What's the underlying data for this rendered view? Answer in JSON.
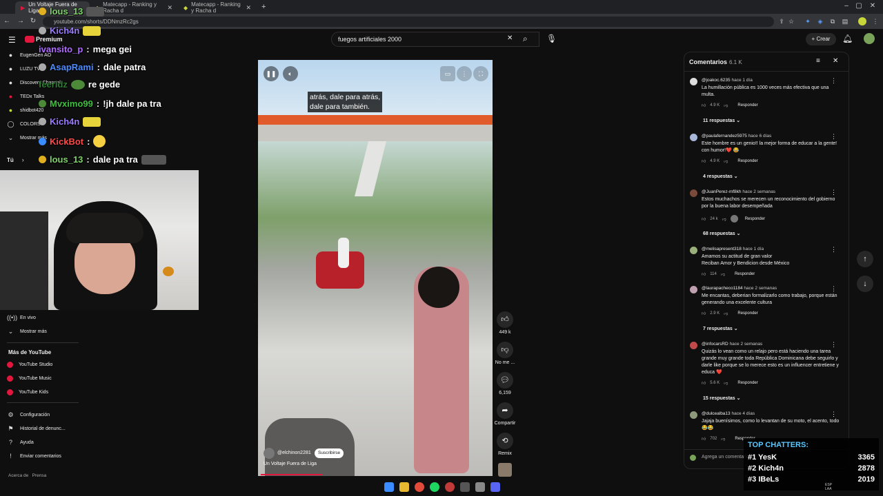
{
  "browser": {
    "tabs": [
      {
        "label": "Un Voltaje Fuera de Liga"
      },
      {
        "label": "Matecapp - Ranking y Racha d"
      },
      {
        "label": "Matecapp - Ranking y Racha d"
      }
    ],
    "url": "youtube.com/shorts/DDNmzRc2gs"
  },
  "youtube": {
    "logo_label": "Premium",
    "search_value": "fuegos artificiales 2000",
    "create_label": "Crear"
  },
  "sidebar": {
    "subscriptions": [
      "EugenGen AO",
      "LUZU TV",
      "Discovery Channel",
      "TEDx Talks",
      "shidbot420",
      "COLORS",
      "Mostrar más"
    ],
    "you_label": "Tú",
    "live_label": "En vivo",
    "show_more": "Mostrar más",
    "more_heading": "Más de YouTube",
    "more_items": [
      "YouTube Studio",
      "YouTube Music",
      "YouTube Kids"
    ],
    "settings_items": [
      "Configuración",
      "Historial de denunc...",
      "Ayuda",
      "Enviar comentarios"
    ],
    "footer": "Acerca de   Prensa"
  },
  "chat_overlay": [
    {
      "user": "lous_13",
      "message": "",
      "color": "#7fd36a"
    },
    {
      "user": "Kich4n",
      "message": "",
      "color": "#9b7bff"
    },
    {
      "user": "ivansito_p",
      "message": "mega gei",
      "color": "#b06bff"
    },
    {
      "user": "AsapRami",
      "message": "dale patra",
      "color": "#4a8cff"
    },
    {
      "user": "feerldz",
      "message": "re gede",
      "color": "#2e7d32"
    },
    {
      "user": "Mvximo99",
      "message": "!jh dale pa tra",
      "color": "#3fbf3f"
    },
    {
      "user": "Kich4n",
      "message": "",
      "color": "#9b7bff"
    },
    {
      "user": "KickBot",
      "message": "",
      "color": "#ff4a4a"
    },
    {
      "user": "lous_13",
      "message": "dale pa tra",
      "color": "#7fd36a"
    }
  ],
  "video": {
    "caption": "atrás, dale para atrás,\ndale para también.",
    "channel": "@elchinon2281",
    "subscribe_label": "Suscribirse",
    "title": "Un Voltaje Fuera de Liga",
    "likes": "449 k",
    "dislike_label": "No me ...",
    "comments_count": "6,159",
    "share_label": "Compartir",
    "remix_label": "Remix"
  },
  "comments_panel": {
    "title": "Comentarios",
    "count": "6.1 K",
    "reply_label": "Responder",
    "add_placeholder": "Agrega un comentario...",
    "items": [
      {
        "author": "@joakoc.6235",
        "time": "hace 1 día",
        "text": "La humillación pública es 1000 veces más efectiva que una multa.",
        "likes": "4.9 K",
        "replies": "11 respuestas",
        "avatar_color": "#dddddd"
      },
      {
        "author": "@paulafernandez5975",
        "time": "hace 6 días",
        "text": "Este hombre es un genio!! la mejor forma de educar a la gente! con humor!❤️ 😂",
        "likes": "4.9 K",
        "replies": "4 respuestas",
        "avatar_color": "#a8b8d8"
      },
      {
        "author": "@JuanPerez-mf8kh",
        "time": "hace 2 semanas",
        "text": "Estos muchachos se merecen un reconocimiento del gobierno por la buena labor desempeñada",
        "likes": "24 k",
        "replies": "68 respuestas",
        "avatar_color": "#7a4a3a"
      },
      {
        "author": "@melisapresent318",
        "time": "hace 1 día",
        "text": "Amamos su actitud de gran valor\nReciban Amor y Bendicion desde México",
        "likes": "114",
        "replies": "",
        "avatar_color": "#9ab07a"
      },
      {
        "author": "@laurapacheco1184",
        "time": "hace 2 semanas",
        "text": "Me encantas, deberian formalizarlo como trabajo, porque están generando una excelente cultura",
        "likes": "2.9 K",
        "replies": "7 respuestas",
        "avatar_color": "#c0a0b0"
      },
      {
        "author": "@infocarsRD",
        "time": "hace 2 semanas",
        "text": "Quizás lo vean como un relajo pero está haciendo una tarea grande muy grande toda República Dominicana debe seguirlo y darle like porque se lo merece esto es un influencer entretiene y educa ❤️",
        "likes": "5.6 K",
        "replies": "15 respuestas",
        "avatar_color": "#c04a4a"
      },
      {
        "author": "@dulcealba13",
        "time": "hace 4 días",
        "text": "Jajaja buenísimos, como lo levantan de su moto, el acento, todo 😂😂",
        "likes": "702",
        "replies": "",
        "avatar_color": "#8a9a7a"
      }
    ]
  },
  "top_chatters": {
    "title": "TOP CHATTERS:",
    "rows": [
      {
        "rank": "#1",
        "name": "YesK",
        "count": "3365"
      },
      {
        "rank": "#2",
        "name": "Kich4n",
        "count": "2878"
      },
      {
        "rank": "#3",
        "name": "IBeLs",
        "count": "2019"
      }
    ]
  },
  "taskbar": {
    "lang": "ESP\nLAA"
  }
}
